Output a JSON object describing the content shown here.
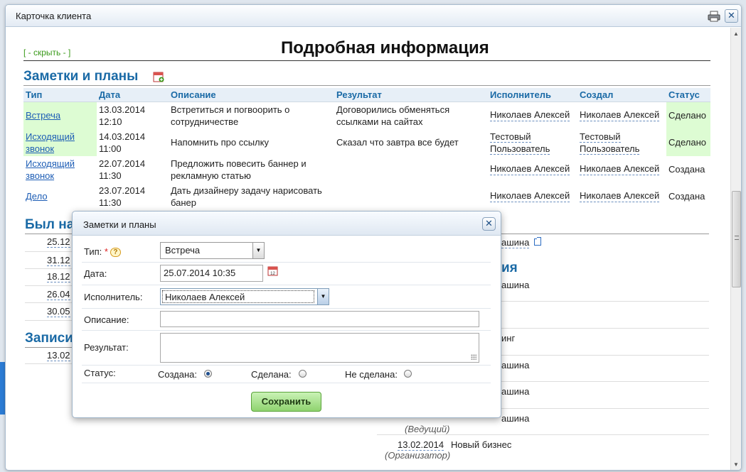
{
  "window": {
    "title": "Карточка клиента",
    "icons": [
      "print-icon",
      "close-icon"
    ]
  },
  "page": {
    "hide_link": "[ - скрыть - ]",
    "title": "Подробная информация"
  },
  "notes_section": {
    "title": "Заметки и планы",
    "columns": [
      "Тип",
      "Дата",
      "Описание",
      "Результат",
      "Исполнитель",
      "Создал",
      "Статус"
    ],
    "rows": [
      {
        "type": "Встреча",
        "date": "13.03.2014",
        "time": "12:10",
        "description": "Встретиться и погвоорить о сотрудничестве",
        "result": "Договорились обменяться ссылками на сайтах",
        "executor": "Николаев Алексей",
        "creator": "Николаев Алексей",
        "status": "Сделано",
        "done": true
      },
      {
        "type": "Исходящий звонок",
        "date": "14.03.2014",
        "time": "11:00",
        "description": "Напомнить про ссылку",
        "result": "Сказал что завтра все будет",
        "executor": "Тестовый Пользователь",
        "creator": "Тестовый Пользователь",
        "status": "Сделано",
        "done": true
      },
      {
        "type": "Исходящий звонок",
        "date": "22.07.2014",
        "time": "11:30",
        "description": "Предложить повесить баннер и рекламную статью",
        "result": "",
        "executor": "Николаев Алексей",
        "creator": "Николаев Алексей",
        "status": "Создана",
        "done": false
      },
      {
        "type": "Дело",
        "date": "23.07.2014",
        "time": "11:30",
        "description": "Дать дизайнеру задачу нарисовать банер",
        "result": "",
        "executor": "Николаев Алексей",
        "creator": "Николаев Алексей",
        "status": "Создана",
        "done": false
      }
    ]
  },
  "background": {
    "section2_title": "Был на",
    "section2_dates": [
      "25.12",
      "31.12",
      "18.12",
      "26.04",
      "30.05"
    ],
    "section3_title": "Записи",
    "section3_dates": [
      "13.02"
    ],
    "right_texts": [
      "ашина",
      "ия",
      "ашина",
      "инг",
      "ашина",
      "ашина",
      "ашина"
    ],
    "role1": "(Ведущий)",
    "last_date": "13.02.2014",
    "last_text": "Новый бизнес",
    "role2": "(Организатор)"
  },
  "dialog": {
    "title": "Заметки и планы",
    "type_label": "Тип:",
    "required_mark": "*",
    "help_glyph": "?",
    "type_value": "Встреча",
    "date_label": "Дата:",
    "date_value": "25.07.2014 10:35",
    "executor_label": "Исполнитель:",
    "executor_value": "Николаев Алексей",
    "description_label": "Описание:",
    "description_value": "",
    "result_label": "Результат:",
    "result_value": "",
    "status_label": "Статус:",
    "status_options": [
      "Создана:",
      "Сделана:",
      "Не сделана:"
    ],
    "status_selected": 0,
    "save_label": "Сохранить"
  }
}
